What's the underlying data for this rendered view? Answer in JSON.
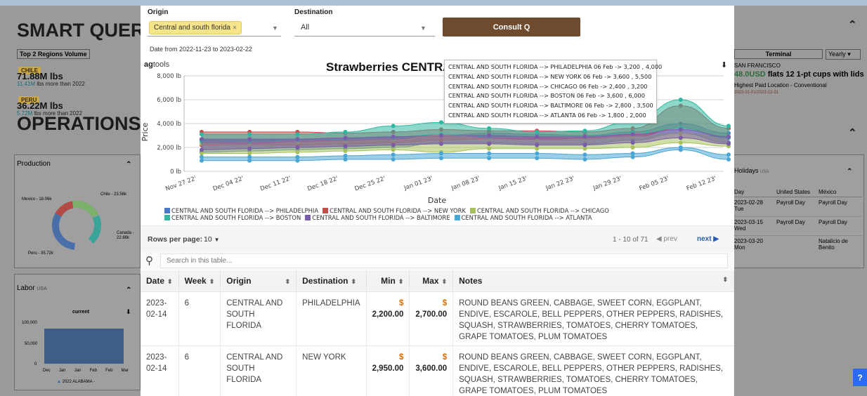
{
  "background": {
    "title_smart_query": "SMART QUERY",
    "title_operations": "OPERATIONS",
    "volume_tab": "Top 2 Regions Volume",
    "regions": [
      {
        "name": "CHILE",
        "value": "71.88M lbs",
        "delta_num": "11.41M",
        "delta_text": " lbs more than 2022"
      },
      {
        "name": "PERU",
        "value": "36.22M lbs",
        "delta_num": "5.72M",
        "delta_text": " lbs more than 2022"
      }
    ],
    "terminal_tab": "Terminal",
    "terminal_period": "Yearly",
    "terminal_city": "SAN FRANCISCO",
    "terminal_price_num": "48.0USD",
    "terminal_price_text": " flats 12 1-pt cups with lids",
    "terminal_sub": "Highest Paid Location - Conventional",
    "terminal_date": "2023-01-01/2023-12-31",
    "production_label": "Production",
    "donut_labels": {
      "mexico": "Mexico - 18.06k",
      "chile": "Chile - 23.56k",
      "canada": "Canada - 22.66k",
      "peru": "Peru - 35.72k"
    },
    "labor_label": "Labor",
    "labor_sub": "USA",
    "labor_chart_title": "current",
    "labor_y_ticks": [
      "100,000",
      "50,000",
      "0"
    ],
    "labor_x_ticks": [
      "Dec",
      "Jan",
      "Jan",
      "Feb",
      "Feb",
      "Mar"
    ],
    "labor_legend": "2022 ALABAMA -",
    "holidays_label": "Holidays",
    "holidays_sub": "USA",
    "holidays_head": [
      "Day",
      "United States",
      "México"
    ],
    "holidays_rows": [
      {
        "date": "2023-02-28",
        "dow": "Tue",
        "us": "Payroll Day",
        "mx": "Payroll Day"
      },
      {
        "date": "2023-03-15",
        "dow": "Wed",
        "us": "Payroll Day",
        "mx": "Payroll Day"
      },
      {
        "date": "2023-03-20",
        "dow": "Mon",
        "us": "",
        "mx": "Natalicio de Benito"
      }
    ]
  },
  "filters": {
    "origin_label": "Origin",
    "origin_chip": "Central and south florida",
    "destination_label": "Destination",
    "destination_value": "All",
    "consult_label": "Consult Q",
    "date_range": "Date from 2022-11-23 to 2023-02-22"
  },
  "brand": {
    "prefix": "ag",
    "suffix": "tools"
  },
  "chart_data": {
    "type": "area",
    "title": "Strawberries CENTRAL",
    "xlabel": "Date",
    "ylabel": "Price",
    "ylim": [
      0,
      8000
    ],
    "y_ticks": [
      "0 lb",
      "2,000 lb",
      "4,000 lb",
      "6,000 lb",
      "8,000 lb"
    ],
    "x_tick_labels": [
      "Nov 27 22",
      "Dec 04 22",
      "Dec 11 22",
      "Dec 18 22",
      "Dec 25 22",
      "Jan 01 23",
      "Jan 08 23",
      "Jan 15 23",
      "Jan 22 23",
      "Jan 29 23",
      "Feb 05 23",
      "Feb 12 23"
    ],
    "x_points": [
      "Dec 01 22",
      "Dec 08 22",
      "Dec 15 22",
      "Dec 22 22",
      "Dec 29 22",
      "Jan 05 23",
      "Jan 12 23",
      "Jan 19 23",
      "Jan 26 23",
      "Feb 02 23",
      "Feb 06 23",
      "Feb 13 23"
    ],
    "grid": true,
    "legend_position": "bottom",
    "series": [
      {
        "name": "CENTRAL AND SOUTH FLORIDA --> PHILADELPHIA",
        "color": "#4a78c4",
        "min": [
          1600,
          1700,
          1800,
          1900,
          2000,
          2400,
          2400,
          2300,
          2300,
          2600,
          3200,
          2400
        ],
        "max": [
          2600,
          2600,
          2700,
          2800,
          2900,
          3000,
          3200,
          3100,
          3000,
          3300,
          4000,
          3200
        ]
      },
      {
        "name": "CENTRAL AND SOUTH FLORIDA --> NEW YORK",
        "color": "#c84c4c",
        "min": [
          2200,
          2200,
          2200,
          2300,
          2400,
          2600,
          2700,
          2700,
          2700,
          2900,
          3600,
          2900
        ],
        "max": [
          3300,
          3300,
          3300,
          3200,
          3300,
          3500,
          3400,
          3400,
          3300,
          3600,
          5500,
          3600
        ]
      },
      {
        "name": "CENTRAL AND SOUTH FLORIDA --> CHICAGO",
        "color": "#a7c25a",
        "min": [
          1500,
          1500,
          1600,
          1700,
          1800,
          1600,
          1900,
          1900,
          1900,
          2000,
          2400,
          2100
        ],
        "max": [
          2300,
          2200,
          2400,
          2500,
          2600,
          3100,
          2700,
          2600,
          2700,
          2900,
          3200,
          2800
        ]
      },
      {
        "name": "CENTRAL AND SOUTH FLORIDA --> BOSTON",
        "color": "#2fb8a1",
        "min": [
          2500,
          2500,
          2600,
          2700,
          2800,
          3100,
          2900,
          2900,
          2900,
          3200,
          3600,
          2800
        ],
        "max": [
          3100,
          3100,
          3100,
          3300,
          3800,
          4100,
          3600,
          3300,
          3400,
          4200,
          6000,
          3800
        ]
      },
      {
        "name": "CENTRAL AND SOUTH FLORIDA --> BALTIMORE",
        "color": "#7b5ca8",
        "min": [
          1800,
          1900,
          2000,
          2100,
          2200,
          2300,
          2300,
          2200,
          2200,
          2400,
          2800,
          2300
        ],
        "max": [
          2700,
          2700,
          2700,
          2800,
          2900,
          3000,
          3000,
          2900,
          2900,
          3100,
          3500,
          2900
        ]
      },
      {
        "name": "CENTRAL AND SOUTH FLORIDA --> ATLANTA",
        "color": "#4aa6d4",
        "min": [
          900,
          900,
          900,
          1000,
          1000,
          1100,
          1100,
          1100,
          1000,
          1200,
          1800,
          1000
        ],
        "max": [
          1200,
          1200,
          1200,
          1300,
          1400,
          1500,
          1500,
          1500,
          1400,
          1500,
          2000,
          1400
        ]
      }
    ],
    "tooltip_lines": [
      "CENTRAL AND SOUTH FLORIDA --> PHILADELPHIA 06 Feb -> 3,200 , 4,000",
      "CENTRAL AND SOUTH FLORIDA --> NEW YORK 06 Feb -> 3,600 , 5,500",
      "CENTRAL AND SOUTH FLORIDA --> CHICAGO 06 Feb -> 2,400 , 3,200",
      "CENTRAL AND SOUTH FLORIDA --> BOSTON 06 Feb -> 3,600 , 6,000",
      "CENTRAL AND SOUTH FLORIDA --> BALTIMORE 06 Feb -> 2,800 , 3,500",
      "CENTRAL AND SOUTH FLORIDA --> ATLANTA 06 Feb -> 1,800 , 2,000"
    ]
  },
  "pager": {
    "rows_label": "Rows per page:",
    "rows_value": "10",
    "range": "1 - 10 of 71",
    "prev": "prev",
    "next": "next"
  },
  "search": {
    "placeholder": "Search in this table..."
  },
  "table": {
    "columns": [
      "Date",
      "Week",
      "Origin",
      "Destination",
      "Min",
      "Max",
      "Notes"
    ],
    "rows": [
      {
        "date": "2023-02-14",
        "week": "6",
        "origin": "CENTRAL AND SOUTH FLORIDA",
        "destination": "PHILADELPHIA",
        "min": "2,200.00",
        "max": "2,700.00",
        "notes": "ROUND BEANS GREEN, CABBAGE, SWEET CORN, EGGPLANT, ENDIVE, ESCAROLE, BELL PEPPERS, OTHER PEPPERS, RADISHES, SQUASH, STRAWBERRIES, TOMATOES, CHERRY TOMATOES, GRAPE TOMATOES, PLUM TOMATOES"
      },
      {
        "date": "2023-02-14",
        "week": "6",
        "origin": "CENTRAL AND SOUTH FLORIDA",
        "destination": "NEW YORK",
        "min": "2,950.00",
        "max": "3,600.00",
        "notes": "ROUND BEANS GREEN, CABBAGE, SWEET CORN, EGGPLANT, ENDIVE, ESCAROLE, BELL PEPPERS, OTHER PEPPERS, RADISHES, SQUASH, STRAWBERRIES, TOMATOES, CHERRY TOMATOES, GRAPE TOMATOES, PLUM TOMATOES"
      }
    ]
  },
  "colors": {
    "consult": "#6e4a2e",
    "chip": "#f6e48a",
    "dollar": "#d86c00",
    "help": "#2a6bf0"
  },
  "help_label": "?"
}
